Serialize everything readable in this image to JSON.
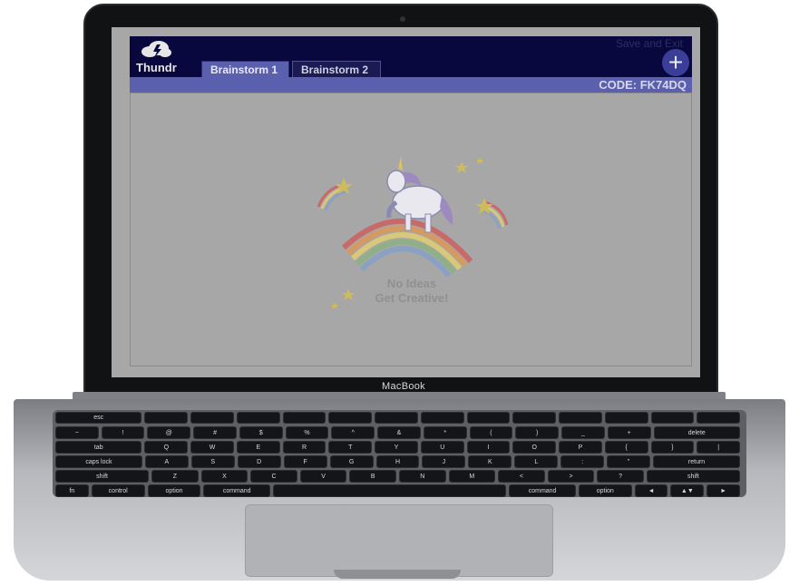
{
  "app": {
    "name": "Thundr",
    "tabs": [
      {
        "label": "Brainstorm 1",
        "active": true
      },
      {
        "label": "Brainstorm 2",
        "active": false
      }
    ],
    "save_exit_label": "Save and Exit",
    "add_icon": "plus-icon",
    "code_label": "CODE: FK74DQ",
    "empty_state": {
      "line1": "No Ideas",
      "line2": "Get Creative!"
    }
  },
  "device": {
    "brand": "MacBook"
  },
  "keyboard": {
    "row1": [
      "esc",
      "",
      "",
      "",
      "",
      "",
      "",
      "",
      "",
      "",
      "",
      "",
      "",
      ""
    ],
    "row2": [
      "~",
      "!",
      "@",
      "#",
      "$",
      "%",
      "^",
      "&",
      "*",
      "(",
      ")",
      "_",
      "+",
      "delete"
    ],
    "row3": [
      "tab",
      "Q",
      "W",
      "E",
      "R",
      "T",
      "Y",
      "U",
      "I",
      "O",
      "P",
      "{",
      "}",
      "|"
    ],
    "row4": [
      "caps lock",
      "A",
      "S",
      "D",
      "F",
      "G",
      "H",
      "J",
      "K",
      "L",
      ":",
      "\"",
      "return"
    ],
    "row5": [
      "shift",
      "Z",
      "X",
      "C",
      "V",
      "B",
      "N",
      "M",
      "<",
      ">",
      "?",
      "shift"
    ],
    "row6": [
      "fn",
      "control",
      "option",
      "command",
      "",
      "command",
      "option",
      "◄",
      "▲▼",
      "►"
    ]
  },
  "colors": {
    "app_bar": "#08083f",
    "accent": "#5a5fae",
    "screen_overlay": "#a7a7a7"
  }
}
